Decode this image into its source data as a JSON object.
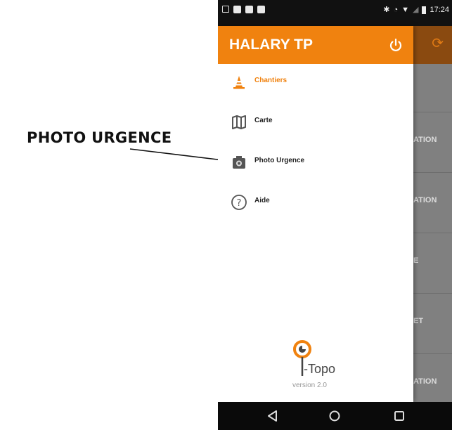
{
  "annotation": {
    "label": "PHOTO URGENCE"
  },
  "status_bar": {
    "time": "17:24",
    "icons": [
      "gallery-icon",
      "photo-icon",
      "photo-icon",
      "photo-icon",
      "bluetooth-icon",
      "alarm-icon",
      "wifi-icon",
      "signal-icon",
      "battery-icon"
    ]
  },
  "drawer": {
    "title": "HALARY TP",
    "accent_color": "#f0820f",
    "items": [
      {
        "label": "Chantiers",
        "icon": "traffic-cone-icon",
        "active": true
      },
      {
        "label": "Carte",
        "icon": "map-icon",
        "active": false
      },
      {
        "label": "Photo Urgence",
        "icon": "camera-icon",
        "active": false
      },
      {
        "label": "Aide",
        "icon": "help-icon",
        "active": false
      }
    ],
    "logo": {
      "name": "i-Topo",
      "version": "version 2.0"
    }
  },
  "background_list": {
    "rows": [
      "ATION",
      "ATION",
      "E",
      "ET",
      "ATION"
    ]
  },
  "nav_bar": {
    "buttons": [
      "back-icon",
      "home-icon",
      "recents-icon"
    ]
  }
}
